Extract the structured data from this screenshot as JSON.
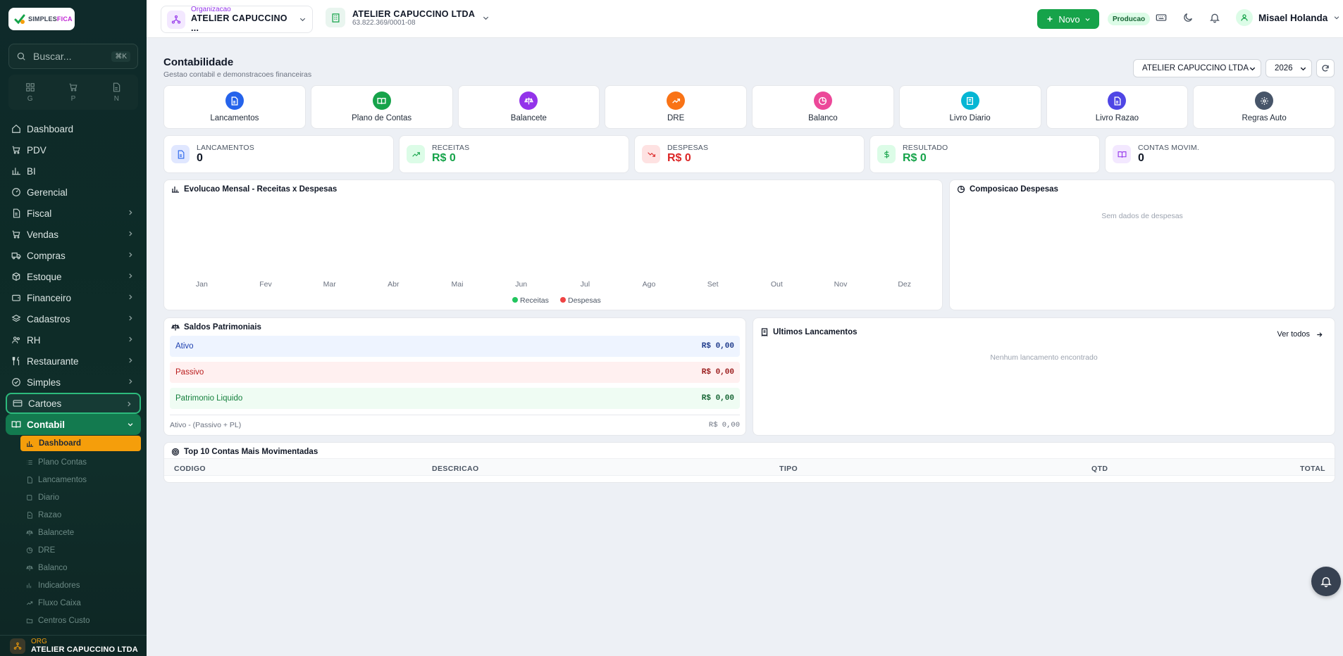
{
  "brand": {
    "logo_text_a": "SIMPLES",
    "logo_text_b": "FICA"
  },
  "sidebar": {
    "search_placeholder": "Buscar...",
    "search_shortcut": "⌘K",
    "quick": [
      {
        "label": "G"
      },
      {
        "label": "P"
      },
      {
        "label": "N"
      }
    ],
    "items": [
      {
        "label": "Dashboard"
      },
      {
        "label": "PDV"
      },
      {
        "label": "BI"
      },
      {
        "label": "Gerencial"
      },
      {
        "label": "Fiscal"
      },
      {
        "label": "Vendas"
      },
      {
        "label": "Compras"
      },
      {
        "label": "Estoque"
      },
      {
        "label": "Financeiro"
      },
      {
        "label": "Cadastros"
      },
      {
        "label": "RH"
      },
      {
        "label": "Restaurante"
      },
      {
        "label": "Simples"
      },
      {
        "label": "Cartoes"
      },
      {
        "label": "Contabil"
      }
    ],
    "sub_items": [
      {
        "label": "Dashboard"
      },
      {
        "label": "Plano Contas"
      },
      {
        "label": "Lancamentos"
      },
      {
        "label": "Diario"
      },
      {
        "label": "Razao"
      },
      {
        "label": "Balancete"
      },
      {
        "label": "DRE"
      },
      {
        "label": "Balanco"
      },
      {
        "label": "Indicadores"
      },
      {
        "label": "Fluxo Caixa"
      },
      {
        "label": "Centros Custo"
      }
    ],
    "footer": {
      "label": "ORG",
      "value": "ATELIER CAPUCCINO LTDA"
    }
  },
  "topbar": {
    "org_label": "Organizacao",
    "org_value": "ATELIER CAPUCCINO ...",
    "company_name": "ATELIER CAPUCCINO LTDA",
    "company_cnpj": "63.822.369/0001-08",
    "new_label": "Novo",
    "env_badge": "Producao",
    "user_name": "Misael Holanda"
  },
  "page": {
    "title": "Contabilidade",
    "subtitle": "Gestao contabil e demonstracoes financeiras",
    "company_select": "ATELIER CAPUCCINO LTDA",
    "year_select": "2026"
  },
  "tiles": [
    {
      "label": "Lancamentos",
      "color": "#2563eb"
    },
    {
      "label": "Plano de Contas",
      "color": "#16a34a"
    },
    {
      "label": "Balancete",
      "color": "#9333ea"
    },
    {
      "label": "DRE",
      "color": "#f97316"
    },
    {
      "label": "Balanco",
      "color": "#ec4899"
    },
    {
      "label": "Livro Diario",
      "color": "#06b6d4"
    },
    {
      "label": "Livro Razao",
      "color": "#4f46e5"
    },
    {
      "label": "Regras Auto",
      "color": "#475569"
    }
  ],
  "stats": [
    {
      "label": "LANCAMENTOS",
      "value": "0",
      "color": "#111827",
      "bg": "#e0e7ff",
      "icon_color": "#2563eb"
    },
    {
      "label": "RECEITAS",
      "value": "R$ 0",
      "color": "#16a34a",
      "bg": "#dcfce7",
      "icon_color": "#16a34a"
    },
    {
      "label": "DESPESAS",
      "value": "R$ 0",
      "color": "#dc2626",
      "bg": "#fee2e2",
      "icon_color": "#dc2626"
    },
    {
      "label": "RESULTADO",
      "value": "R$ 0",
      "color": "#16a34a",
      "bg": "#dcfce7",
      "icon_color": "#16a34a"
    },
    {
      "label": "CONTAS MOVIM.",
      "value": "0",
      "color": "#111827",
      "bg": "#f3e8ff",
      "icon_color": "#9333ea"
    }
  ],
  "chart_data": {
    "type": "bar",
    "title": "Evolucao Mensal - Receitas x Despesas",
    "categories": [
      "Jan",
      "Fev",
      "Mar",
      "Abr",
      "Mai",
      "Jun",
      "Jul",
      "Ago",
      "Set",
      "Out",
      "Nov",
      "Dez"
    ],
    "series": [
      {
        "name": "Receitas",
        "color": "#22c55e",
        "values": [
          0,
          0,
          0,
          0,
          0,
          0,
          0,
          0,
          0,
          0,
          0,
          0
        ]
      },
      {
        "name": "Despesas",
        "color": "#ef4444",
        "values": [
          0,
          0,
          0,
          0,
          0,
          0,
          0,
          0,
          0,
          0,
          0,
          0
        ]
      }
    ],
    "legend": "bottom"
  },
  "composicao": {
    "title": "Composicao Despesas",
    "empty": "Sem dados de despesas"
  },
  "saldos": {
    "title": "Saldos Patrimoniais",
    "rows": [
      {
        "label": "Ativo",
        "value": "R$ 0,00"
      },
      {
        "label": "Passivo",
        "value": "R$ 0,00"
      },
      {
        "label": "Patrimonio Liquido",
        "value": "R$ 0,00"
      }
    ],
    "check_label": "Ativo - (Passivo + PL)",
    "check_value": "R$ 0,00"
  },
  "ultimos": {
    "title": "Ultimos Lancamentos",
    "link": "Ver todos",
    "empty": "Nenhum lancamento encontrado"
  },
  "top10": {
    "title": "Top 10 Contas Mais Movimentadas",
    "columns": [
      "CODIGO",
      "DESCRICAO",
      "TIPO",
      "QTD",
      "TOTAL"
    ]
  }
}
